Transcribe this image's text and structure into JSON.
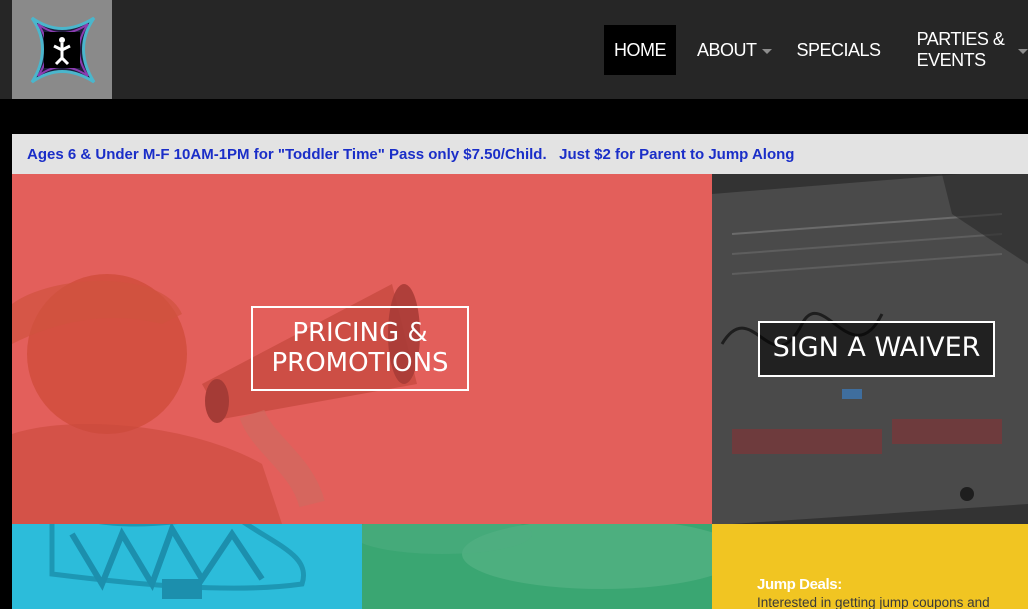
{
  "nav": {
    "items": [
      {
        "label": "HOME",
        "active": true
      },
      {
        "label": "ABOUT",
        "has_dropdown": true
      },
      {
        "label": "SPECIALS"
      },
      {
        "label": "PARTIES & EVENTS",
        "has_dropdown": true
      }
    ]
  },
  "announcement": {
    "part1": "Ages 6 & Under M-F 10AM-1PM for \"Toddler Time\" Pass only $7.50/Child.",
    "part2": "Just $2 for Parent to Jump Along"
  },
  "tiles": {
    "pricing": {
      "line1": "PRICING &",
      "line2": "PROMOTIONS"
    },
    "waiver": {
      "label": "SIGN A WAIVER"
    },
    "deals": {
      "title": "Jump Deals:",
      "text": "Interested in getting jump coupons and"
    }
  },
  "colors": {
    "topbar": "#262626",
    "logo_bg": "#8a8a8a",
    "announcement_text": "#1a2ec8",
    "pricing_tile": "#e35f5b",
    "blue_tile": "#2cbcda",
    "green_tile": "#3aa672",
    "yellow_tile": "#f1c522"
  },
  "icons": {
    "logo": "altitude-logo-icon",
    "dropdown": "caret-down-icon"
  }
}
